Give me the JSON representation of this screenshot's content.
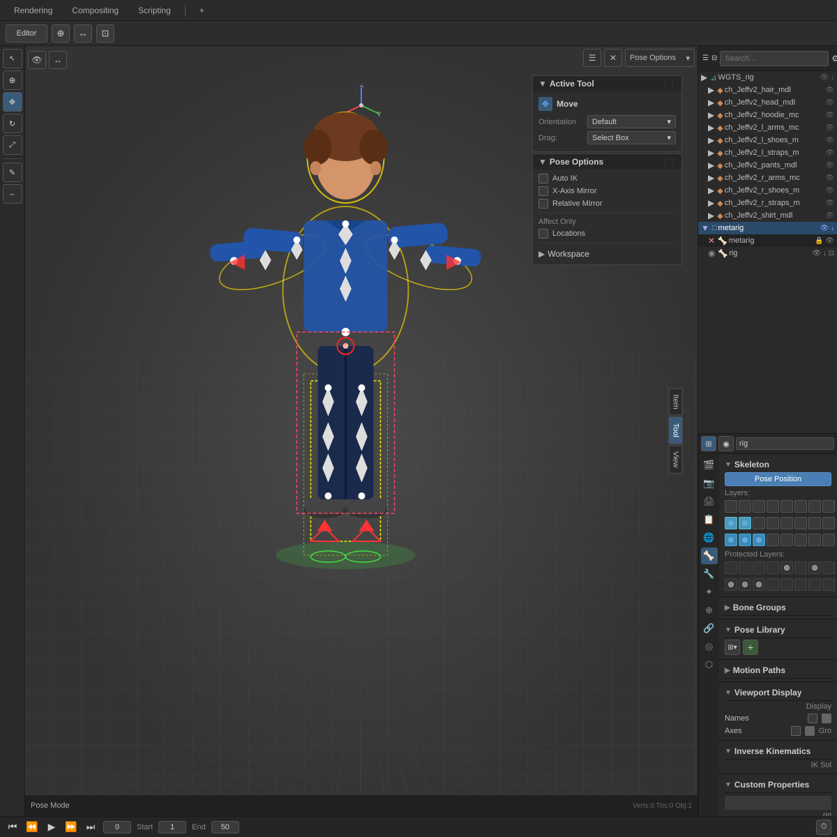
{
  "tabs": {
    "rendering": "Rendering",
    "compositing": "Compositing",
    "scripting": "Scripting",
    "plus": "+"
  },
  "viewport": {
    "pose_options_title": "Pose Options",
    "active_tool_title": "Active Tool",
    "tool_name": "Move",
    "orientation_label": "Orientation",
    "orientation_value": "Default",
    "drag_label": "Drag:",
    "drag_value": "Select Box",
    "pose_options": {
      "auto_ik": "Auto IK",
      "x_axis_mirror": "X-Axis Mirror",
      "relative_mirror": "Relative Mirror"
    },
    "affect_only": "Affect Only",
    "locations": "Locations",
    "workspace": "Workspace"
  },
  "playback": {
    "frame_current": "0",
    "start_label": "Start",
    "start_value": "1",
    "end_label": "End",
    "end_value": "50"
  },
  "outliner": {
    "items": [
      {
        "name": "WGTS_rig",
        "icon": "▶",
        "indent": 0
      },
      {
        "name": "ch_Jeffv2_hair_mdl",
        "icon": "▶",
        "indent": 1
      },
      {
        "name": "ch_Jeffv2_head_mdl",
        "icon": "▶",
        "indent": 1
      },
      {
        "name": "ch_Jeffv2_hoodie_mc",
        "icon": "▶",
        "indent": 1
      },
      {
        "name": "ch_Jeffv2_l_arms_mc",
        "icon": "▶",
        "indent": 1
      },
      {
        "name": "ch_Jeffv2_l_shoes_m",
        "icon": "▶",
        "indent": 1
      },
      {
        "name": "ch_Jeffv2_l_straps_m",
        "icon": "▶",
        "indent": 1
      },
      {
        "name": "ch_Jeffv2_pants_mdl",
        "icon": "▶",
        "indent": 1
      },
      {
        "name": "ch_Jeffv2_r_arms_mc",
        "icon": "▶",
        "indent": 1
      },
      {
        "name": "ch_Jeffv2_r_shoes_m",
        "icon": "▶",
        "indent": 1
      },
      {
        "name": "ch_Jeffv2_r_straps_m",
        "icon": "▶",
        "indent": 1
      },
      {
        "name": "ch_Jeffv2_shirt_mdl",
        "icon": "▶",
        "indent": 1
      },
      {
        "name": "metarig",
        "icon": "▼",
        "indent": 0,
        "selected": true
      },
      {
        "name": "metarig",
        "icon": "✕",
        "indent": 1
      },
      {
        "name": "rig",
        "icon": "◉",
        "indent": 1
      }
    ]
  },
  "properties": {
    "title": "rig",
    "skeleton_title": "Skeleton",
    "pose_position_btn": "Pose Position",
    "layers_label": "Layers:",
    "protected_layers_label": "Protected Layers:",
    "bone_groups_title": "Bone Groups",
    "pose_library_title": "Pose Library",
    "motion_paths_title": "Motion Paths",
    "viewport_display_title": "Viewport Display",
    "display_label": "Display",
    "names_label": "Names",
    "axes_label": "Axes",
    "gro_label": "Gro",
    "inverse_kinematics_title": "Inverse Kinematics",
    "ik_sol_label": "IK Sol",
    "custom_properties_title": "Custom Properties",
    "rig_label": "rig",
    "layer_count": 16,
    "active_layers": [
      7,
      8,
      9,
      10,
      11
    ]
  },
  "icons": {
    "triangle_right": "▶",
    "triangle_down": "▼",
    "close": "✕",
    "search": "🔍",
    "move": "⊕",
    "hand": "✋",
    "camera": "📷",
    "grid": "⊞",
    "eye": "👁",
    "gear": "⚙",
    "plus": "+",
    "circle": "●",
    "diamond": "◆",
    "bone": "🦴",
    "person": "🚶",
    "dots": "⋮⋮",
    "chevron_down": "▾",
    "lock": "🔒"
  },
  "colors": {
    "accent_blue": "#4a7fb5",
    "active_layer": "#4a9aba",
    "bg_dark": "#252525",
    "bg_mid": "#2d2d2d",
    "bg_light": "#3a3a3a",
    "border": "#444",
    "text_bright": "#ccc",
    "text_dim": "#888"
  }
}
